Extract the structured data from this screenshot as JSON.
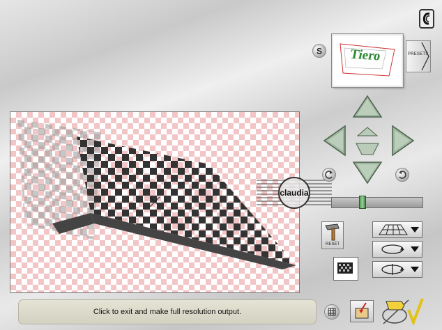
{
  "status": {
    "message": "Click to exit and make full resolution output."
  },
  "presets": {
    "label": "PRESETS"
  },
  "reset": {
    "label": "RESET"
  },
  "thumbnail": {
    "text": "Tiero"
  },
  "watermark": {
    "text": "claudia"
  },
  "slider": {
    "value": 0.33
  },
  "icons": [
    "eye-symbol-icon",
    "s-button-icon",
    "arrow-up-icon",
    "arrow-left-icon",
    "arrow-right-icon",
    "arrow-down-icon",
    "small-up-icon",
    "small-down-icon",
    "rotate-left-icon",
    "rotate-right-icon",
    "hammer-icon",
    "grid-plane-icon",
    "loop-icon",
    "flip-icon",
    "tile-icon",
    "grid-icon",
    "export-icon",
    "hand-check-icon"
  ]
}
